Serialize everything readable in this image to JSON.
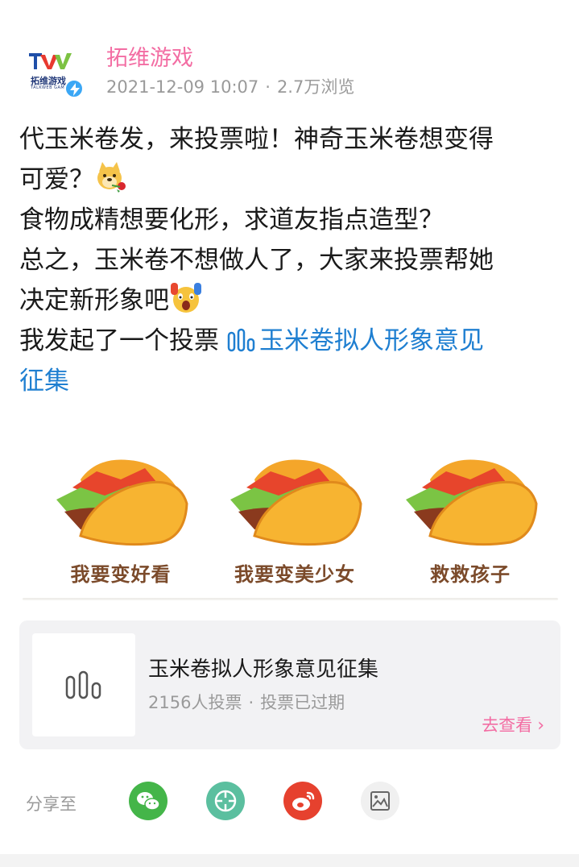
{
  "post": {
    "author": {
      "name": "拓维游戏",
      "avatar_text": "拓维游戏",
      "avatar_sub": "TALKWEB GAME",
      "verified_icon": "lightning-badge-icon"
    },
    "date": "2021-12-09 10:07",
    "separator": "·",
    "views": "2.7万浏览",
    "lines": [
      "代玉米卷发，来投票啦！神奇玉米卷想变得",
      "可爱？",
      "食物成精想要化形，求道友指点造型？",
      "总之，玉米卷不想做人了，大家来投票帮她",
      "决定新形象吧"
    ],
    "vote_intro": " 我发起了一个投票",
    "vote_link_line1": "玉米卷拟人形象意见",
    "vote_link_line2": "征集",
    "emoji_1": "doge-rose-emoji",
    "emoji_2": "screaming-emoji"
  },
  "tacos": [
    {
      "label": "我要变好看"
    },
    {
      "label": "我要变美少女"
    },
    {
      "label": "救救孩子"
    }
  ],
  "poll": {
    "title": "玉米卷拟人形象意见征集",
    "votes": "2156人投票",
    "separator": "·",
    "status": "投票已过期",
    "action": "去查看",
    "icon": "bar-chart-icon"
  },
  "share": {
    "label": "分享至",
    "buttons": [
      {
        "name": "wechat",
        "color": "#44b549"
      },
      {
        "name": "moments",
        "color": "#5bbf9f"
      },
      {
        "name": "weibo",
        "color": "#e6412e"
      },
      {
        "name": "image",
        "color": "#f0f0f0"
      }
    ]
  },
  "colors": {
    "accent_pink": "#f36da3",
    "link_blue": "#1f7fd1",
    "muted": "#9a9a9a"
  }
}
